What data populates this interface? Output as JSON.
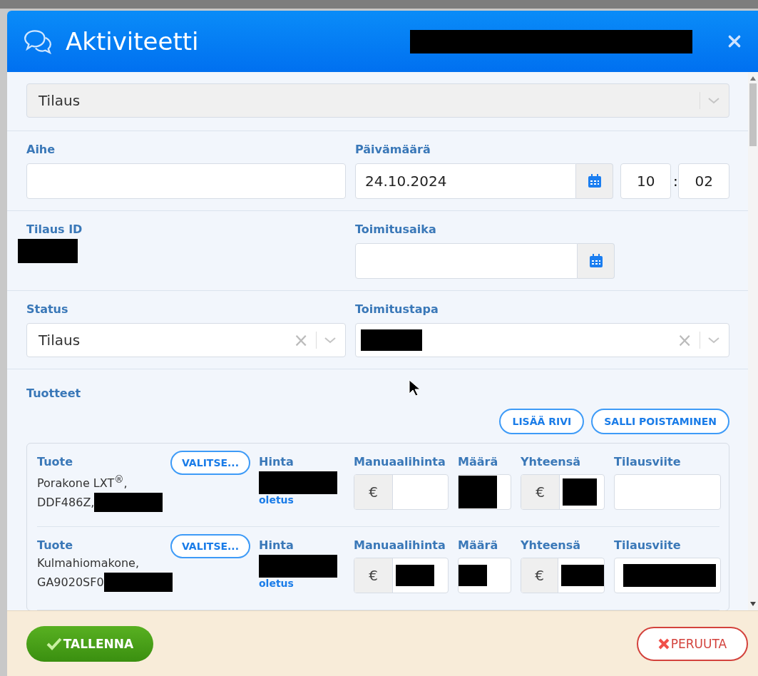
{
  "window": {
    "title": "Aktiviteetti",
    "subtitle_redacted": true
  },
  "type_select": {
    "value": "Tilaus",
    "disabled": true
  },
  "fields": {
    "subject": {
      "label": "Aihe"
    },
    "date": {
      "label": "Päivämäärä",
      "value": "24.10.2024",
      "hour": "10",
      "separator": ":",
      "minute": "02"
    },
    "order_id": {
      "label": "Tilaus ID",
      "redacted": true
    },
    "delivery_time": {
      "label": "Toimitusaika"
    },
    "status": {
      "label": "Status",
      "value": "Tilaus",
      "clear": "×"
    },
    "delivery_method": {
      "label": "Toimitustapa",
      "redacted": true,
      "clear": "×"
    }
  },
  "products": {
    "label": "Tuotteet",
    "buttons": [
      "LISÄÄ RIVI",
      "SALLI POISTAMINEN"
    ],
    "rows": [
      {
        "product_label": "Tuote",
        "choose_button": "VALITSE...",
        "name_lines": [
          "Porakone LXT$^{®}$,",
          "DDF486Z,"
        ],
        "name_redacted": true,
        "price_label": "Hinta",
        "price_redacted": true,
        "price_note": "oletus",
        "manual_label": "Manuaalihinta",
        "currency": "€",
        "manual_redacted": false,
        "qty_label": "Määrä",
        "qty_redacted": true,
        "total_label": "Yhteensä",
        "total_currency": "€",
        "total_redacted": true,
        "ref_label": "Tilausviite",
        "ref_redacted": false
      },
      {
        "product_label": "Tuote",
        "choose_button": "VALITSE...",
        "name_lines": [
          "Kulmahiomakone,",
          "GA9020SF0"
        ],
        "name_redacted": true,
        "price_label": "Hinta",
        "price_redacted": true,
        "price_note": "oletus",
        "manual_label": "Manuaalihinta",
        "currency": "€",
        "manual_redacted": true,
        "qty_label": "Määrä",
        "qty_redacted": true,
        "total_label": "Yhteensä",
        "total_currency": "€",
        "total_redacted": true,
        "ref_label": "Tilausviite",
        "ref_redacted": true
      }
    ]
  },
  "footer": {
    "save": "TALLENNA",
    "cancel": "PERUUTA"
  }
}
